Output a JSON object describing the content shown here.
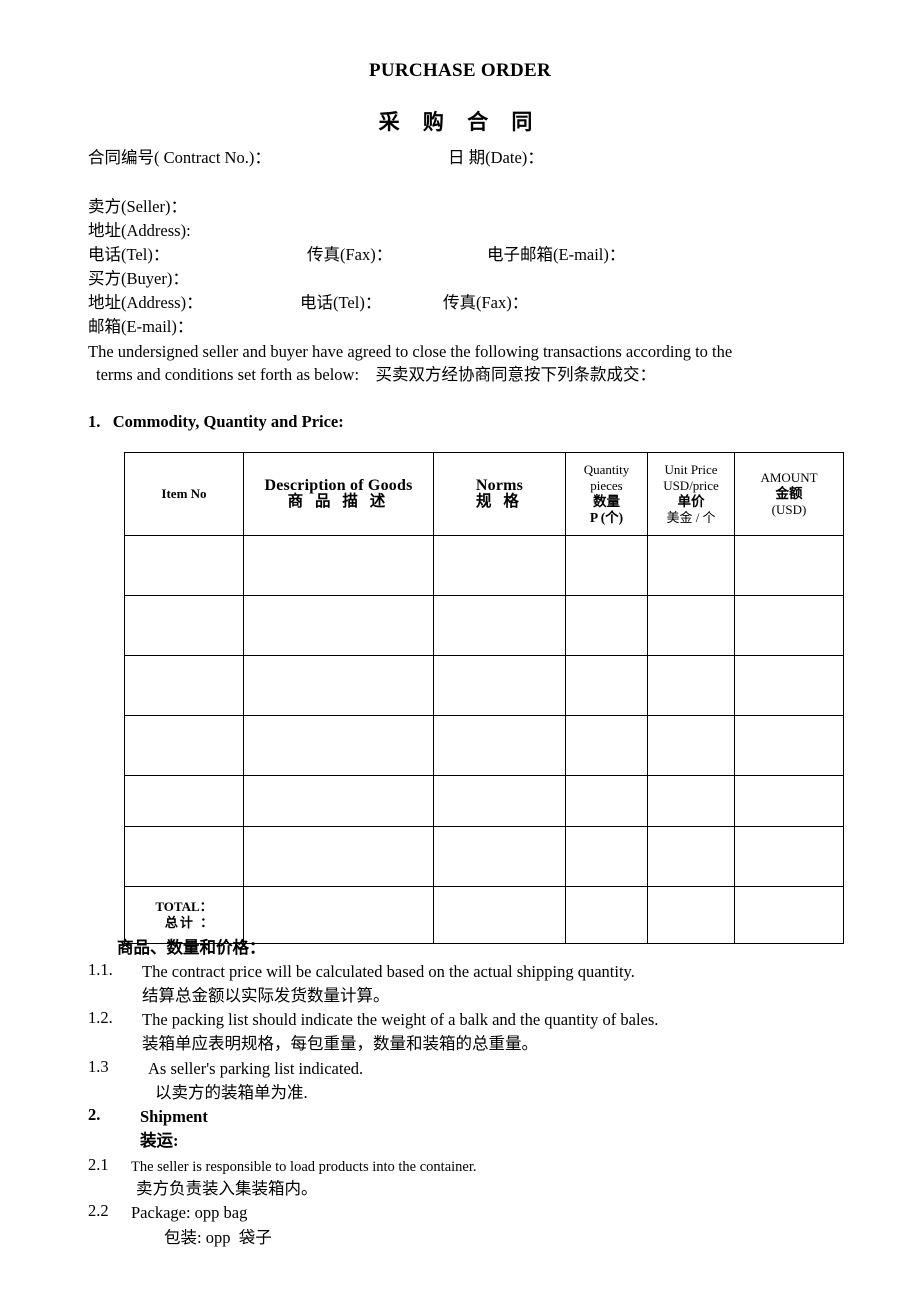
{
  "document": {
    "title_en": "PURCHASE ORDER",
    "title_cn": "采 购 合 同"
  },
  "header_fields": {
    "contract_no": "合同编号( Contract No.)：",
    "date": "日 期(Date)：",
    "seller": "卖方(Seller)：",
    "seller_address": "地址(Address):",
    "seller_tel": "电话(Tel)：",
    "seller_fax": "传真(Fax)：",
    "seller_email": "电子邮箱(E-mail)：",
    "buyer": "买方(Buyer)：",
    "buyer_address": "地址(Address)：",
    "buyer_tel": "电话(Tel)：",
    "buyer_fax": "传真(Fax)：",
    "buyer_email": "邮箱(E-mail)："
  },
  "agreement": {
    "line1": "The undersigned seller and buyer have agreed to close the following transactions according to the",
    "line2": "terms and conditions set forth as below:    买卖双方经协商同意按下列条款成交："
  },
  "sections": {
    "s1_heading": "1.   Commodity, Quantity and Price:",
    "s1_heading_cn": "商品、数量和价格：",
    "s2_heading_num": "2.",
    "s2_heading_en": "Shipment",
    "s2_heading_cn": "装运:"
  },
  "table": {
    "columns": [
      {
        "en": "Item No",
        "cn": ""
      },
      {
        "en": "Description of Goods",
        "cn": "商 品 描 述"
      },
      {
        "en": "Norms",
        "cn": "规 格"
      },
      {
        "en_line1": "Quantity",
        "en_line2": "pieces",
        "cn": "数量",
        "cn_line2": "P (个)"
      },
      {
        "en_line1": "Unit Price",
        "en_line2": "USD/price",
        "cn": "单价",
        "cn_line2": "美金 / 个"
      },
      {
        "en_line1": "AMOUNT",
        "cn": "金额",
        "en_line2": "(USD)"
      }
    ],
    "empty_rows": 6,
    "total_label_en": "TOTAL：",
    "total_label_cn": "总计 ："
  },
  "clauses": [
    {
      "num": "1.1.",
      "en": "The contract price will be calculated based on the actual shipping quantity.",
      "cn": "结算总金额以实际发货数量计算。"
    },
    {
      "num": "1.2.",
      "en": "The packing list should indicate the weight of a balk and the quantity of bales.",
      "cn": "装箱单应表明规格，每包重量，数量和装箱的总重量。"
    },
    {
      "num": "1.3",
      "en": "As seller's parking list indicated.",
      "cn": "以卖方的装箱单为准."
    },
    {
      "num": "2.1",
      "en": "The seller is responsible to load products into the container.",
      "cn": "卖方负责装入集装箱内。"
    },
    {
      "num": "2.2",
      "en": "Package: opp bag",
      "cn": "包装: opp  袋子"
    }
  ]
}
